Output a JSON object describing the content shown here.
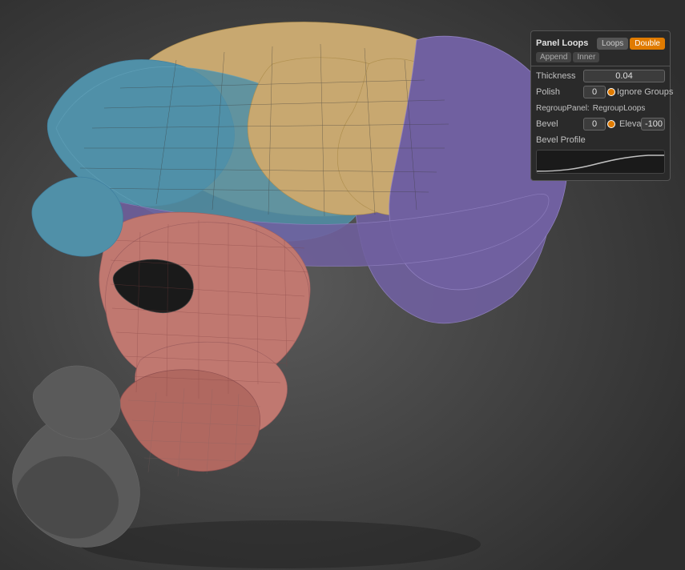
{
  "viewport": {
    "background_color": "#4a4a4a"
  },
  "panel": {
    "title": "Panel Loops",
    "tabs": {
      "loops_label": "Loops",
      "double_label": "Double",
      "double_active": true,
      "sub_tabs": [
        "Append",
        "Inner"
      ]
    },
    "thickness": {
      "label": "Thickness",
      "value": "0.04"
    },
    "polish": {
      "label": "Polish",
      "value": "0",
      "slider_pct": 50,
      "ignore_groups_label": "Ignore Groups"
    },
    "regroup": {
      "panel_label": "RegroupPanel:",
      "loops_label": "RegroupLoops"
    },
    "bevel": {
      "label": "Bevel",
      "value": "0",
      "elevation_label": "Elevation",
      "elevation_value": "-100"
    },
    "bevel_profile": {
      "label": "Bevel Profile"
    }
  }
}
